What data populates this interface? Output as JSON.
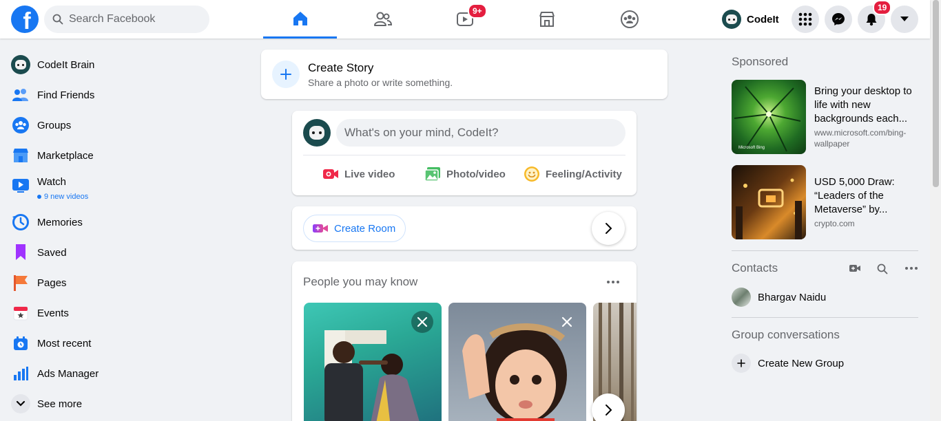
{
  "header": {
    "logo_letter": "f",
    "search_placeholder": "Search Facebook",
    "watch_badge": "9+",
    "notifications_badge": "19",
    "profile_name": "CodeIt",
    "nav_tabs": [
      "home-icon",
      "friends-icon",
      "watch-icon",
      "marketplace-icon",
      "groups-icon"
    ]
  },
  "sidebar": {
    "profile_name": "CodeIt Brain",
    "items": [
      {
        "label": "Find Friends",
        "icon": "friends-icon"
      },
      {
        "label": "Groups",
        "icon": "groups-icon"
      },
      {
        "label": "Marketplace",
        "icon": "marketplace-icon"
      },
      {
        "label": "Watch",
        "icon": "watch-icon"
      },
      {
        "label": "Memories",
        "icon": "memories-icon"
      },
      {
        "label": "Saved",
        "icon": "saved-icon"
      },
      {
        "label": "Pages",
        "icon": "pages-icon"
      },
      {
        "label": "Events",
        "icon": "events-icon"
      },
      {
        "label": "Most recent",
        "icon": "most-recent-icon"
      },
      {
        "label": "Ads Manager",
        "icon": "ads-manager-icon"
      },
      {
        "label": "See more",
        "icon": "chevron-down-icon"
      }
    ],
    "watch_sub": "9 new videos"
  },
  "story": {
    "title": "Create Story",
    "subtitle": "Share a photo or write something."
  },
  "composer": {
    "placeholder": "What's on your mind, CodeIt?",
    "actions": [
      "Live video",
      "Photo/video",
      "Feeling/Activity"
    ]
  },
  "room": {
    "label": "Create Room"
  },
  "pymk": {
    "title": "People you may know"
  },
  "rail": {
    "sponsored_heading": "Sponsored",
    "ads": [
      {
        "title": "Bring your desktop to life with new backgrounds each...",
        "url": "www.microsoft.com/bing-wallpaper",
        "img_caption": "Microsoft Bing"
      },
      {
        "title": "USD 5,000 Draw: “Leaders of the Metaverse” by...",
        "url": "crypto.com"
      }
    ],
    "contacts_heading": "Contacts",
    "contacts": [
      {
        "name": "Bhargav Naidu"
      }
    ],
    "group_heading": "Group conversations",
    "create_group": "Create New Group"
  },
  "colors": {
    "accent": "#1877f2",
    "badge": "#e41e3f",
    "page_bg": "#f0f2f5",
    "secondary_text": "#65676b"
  }
}
